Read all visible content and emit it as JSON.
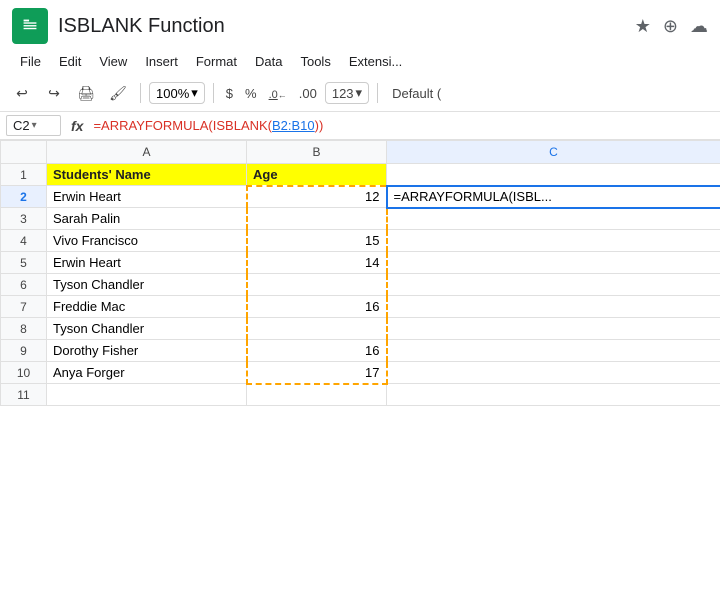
{
  "titleBar": {
    "title": "ISBLANK Function",
    "starIcon": "★",
    "addIcon": "⊕",
    "cloudIcon": "☁"
  },
  "menuBar": {
    "items": [
      "File",
      "Edit",
      "View",
      "Insert",
      "Format",
      "Data",
      "Tools",
      "Extensi..."
    ]
  },
  "toolbar": {
    "undoIcon": "undo-icon",
    "redoIcon": "redo-icon",
    "printIcon": "print-icon",
    "paintIcon": "paint-format-icon",
    "zoom": "100%",
    "zoomArrow": "▾",
    "currency": "$",
    "percent": "%",
    "decZero": ".0",
    "decTwo": ".00",
    "num123": "123",
    "numArrow": "▾",
    "defaultFont": "Default ("
  },
  "formulaBar": {
    "cellRef": "C2",
    "arrow": "▾",
    "fxLabel": "fx",
    "formulaFull": "=ARRAYFORMULA(ISBLANK(B2:B10))",
    "formulaPrefix": "=ARRAYFORMULA(ISBLANK(",
    "formulaRange": "B2:B10",
    "formulaSuffix": "))"
  },
  "columns": {
    "corner": "",
    "a": "A",
    "b": "B",
    "c": "C"
  },
  "rows": [
    {
      "num": "1",
      "a": "Students' Name",
      "b": "Age",
      "c": "",
      "aStyle": "header-yellow",
      "bStyle": "header-yellow"
    },
    {
      "num": "2",
      "a": "Erwin Heart",
      "b": "12",
      "c": "=ARRAYFORMULA(ISBL...",
      "bStyle": "dashed-top"
    },
    {
      "num": "3",
      "a": "Sarah Palin",
      "b": "",
      "c": "",
      "bStyle": "dashed-mid"
    },
    {
      "num": "4",
      "a": "Vivo Francisco",
      "b": "15",
      "c": "",
      "bStyle": "dashed-mid"
    },
    {
      "num": "5",
      "a": "Erwin Heart",
      "b": "14",
      "c": "",
      "bStyle": "dashed-mid"
    },
    {
      "num": "6",
      "a": "Tyson Chandler",
      "b": "",
      "c": "",
      "bStyle": "dashed-mid"
    },
    {
      "num": "7",
      "a": "Freddie Mac",
      "b": "16",
      "c": "",
      "bStyle": "dashed-mid"
    },
    {
      "num": "8",
      "a": "Tyson Chandler",
      "b": "",
      "c": "",
      "bStyle": "dashed-mid"
    },
    {
      "num": "9",
      "a": "Dorothy Fisher",
      "b": "16",
      "c": "",
      "bStyle": "dashed-mid"
    },
    {
      "num": "10",
      "a": "Anya Forger",
      "b": "17",
      "c": "",
      "bStyle": "dashed-bottom"
    },
    {
      "num": "11",
      "a": "",
      "b": "",
      "c": "",
      "bStyle": "normal"
    }
  ]
}
